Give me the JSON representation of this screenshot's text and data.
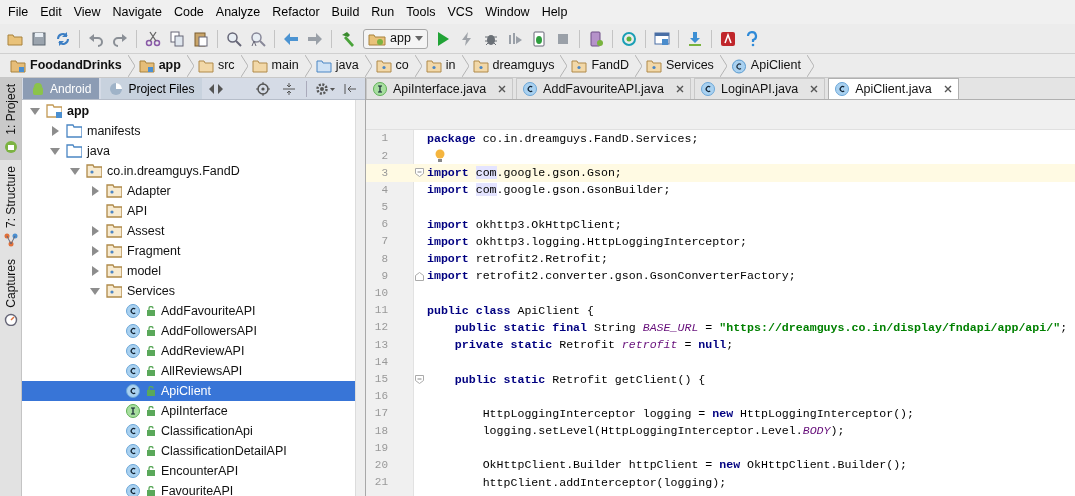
{
  "menu": [
    {
      "label": "File"
    },
    {
      "label": "Edit"
    },
    {
      "label": "View"
    },
    {
      "label": "Navigate"
    },
    {
      "label": "Code"
    },
    {
      "label": "Analyze"
    },
    {
      "label": "Refactor"
    },
    {
      "label": "Build"
    },
    {
      "label": "Run"
    },
    {
      "label": "Tools"
    },
    {
      "label": "VCS"
    },
    {
      "label": "Window"
    },
    {
      "label": "Help"
    }
  ],
  "toolbar": [
    {
      "kind": "open"
    },
    {
      "kind": "save"
    },
    {
      "kind": "sync"
    },
    {
      "kind": "separator"
    },
    {
      "kind": "undo"
    },
    {
      "kind": "redo"
    },
    {
      "kind": "separator"
    },
    {
      "kind": "cut"
    },
    {
      "kind": "copy"
    },
    {
      "kind": "paste"
    },
    {
      "kind": "separator"
    },
    {
      "kind": "find"
    },
    {
      "kind": "replace"
    },
    {
      "kind": "separator"
    },
    {
      "kind": "back"
    },
    {
      "kind": "forward"
    },
    {
      "kind": "separator"
    },
    {
      "kind": "build"
    },
    {
      "kind": "config",
      "label": "app"
    },
    {
      "kind": "run"
    },
    {
      "kind": "lightning"
    },
    {
      "kind": "debug"
    },
    {
      "kind": "profile"
    },
    {
      "kind": "attach"
    },
    {
      "kind": "stop"
    },
    {
      "kind": "separator"
    },
    {
      "kind": "avd"
    },
    {
      "kind": "separator"
    },
    {
      "kind": "gradle"
    },
    {
      "kind": "separator"
    },
    {
      "kind": "structure"
    },
    {
      "kind": "separator"
    },
    {
      "kind": "sdk"
    },
    {
      "kind": "separator"
    },
    {
      "kind": "monitor"
    },
    {
      "kind": "help"
    }
  ],
  "breadcrumbs": [
    {
      "label": "FoodandDrinks",
      "kind": "project"
    },
    {
      "label": "app",
      "kind": "module"
    },
    {
      "label": "src",
      "kind": "folder"
    },
    {
      "label": "main",
      "kind": "folder"
    },
    {
      "label": "java",
      "kind": "source"
    },
    {
      "label": "co",
      "kind": "package"
    },
    {
      "label": "in",
      "kind": "package"
    },
    {
      "label": "dreamguys",
      "kind": "package"
    },
    {
      "label": "FandD",
      "kind": "package"
    },
    {
      "label": "Services",
      "kind": "package"
    },
    {
      "label": "ApiClient",
      "kind": "class"
    }
  ],
  "side_tabs": [
    {
      "label": "1: Project",
      "kind": "project",
      "selected": true
    },
    {
      "label": "7: Structure",
      "kind": "structure",
      "selected": false
    },
    {
      "label": "Captures",
      "kind": "captures",
      "selected": false
    }
  ],
  "project_pane": {
    "views": [
      {
        "label": "Android",
        "kind": "android",
        "selected": true
      },
      {
        "label": "Project Files",
        "kind": "files",
        "selected": false
      }
    ],
    "tree": [
      {
        "label": "app",
        "kind": "module",
        "expanded": true,
        "selected": false,
        "children": [
          {
            "label": "manifests",
            "kind": "folder",
            "expanded": false,
            "selected": false
          },
          {
            "label": "java",
            "kind": "folder",
            "expanded": true,
            "selected": false,
            "children": [
              {
                "label": "co.in.dreamguys.FandD",
                "kind": "package",
                "expanded": true,
                "selected": false,
                "children": [
                  {
                    "label": "Adapter",
                    "kind": "package",
                    "expanded": false,
                    "selected": false
                  },
                  {
                    "label": "API",
                    "kind": "package",
                    "selected": false
                  },
                  {
                    "label": "Assest",
                    "kind": "package",
                    "expanded": false,
                    "selected": false
                  },
                  {
                    "label": "Fragment",
                    "kind": "package",
                    "expanded": false,
                    "selected": false
                  },
                  {
                    "label": "model",
                    "kind": "package",
                    "expanded": false,
                    "selected": false
                  },
                  {
                    "label": "Services",
                    "kind": "package",
                    "expanded": true,
                    "selected": false,
                    "children": [
                      {
                        "label": "AddFavouriteAPI",
                        "kind": "class",
                        "selected": false
                      },
                      {
                        "label": "AddFollowersAPI",
                        "kind": "class",
                        "selected": false
                      },
                      {
                        "label": "AddReviewAPI",
                        "kind": "class",
                        "selected": false
                      },
                      {
                        "label": "AllReviewsAPI",
                        "kind": "class",
                        "selected": false
                      },
                      {
                        "label": "ApiClient",
                        "kind": "class",
                        "selected": true
                      },
                      {
                        "label": "ApiInterface",
                        "kind": "interface",
                        "selected": false
                      },
                      {
                        "label": "ClassificationApi",
                        "kind": "class",
                        "selected": false
                      },
                      {
                        "label": "ClassificationDetailAPI",
                        "kind": "class",
                        "selected": false
                      },
                      {
                        "label": "EncounterAPI",
                        "kind": "class",
                        "selected": false
                      },
                      {
                        "label": "FavouriteAPI",
                        "kind": "class",
                        "selected": false
                      }
                    ]
                  }
                ]
              }
            ]
          }
        ]
      }
    ]
  },
  "editor": {
    "tabs": [
      {
        "label": "ApiInterface.java",
        "kind": "interface",
        "selected": false
      },
      {
        "label": "AddFavouriteAPI.java",
        "kind": "class",
        "selected": false
      },
      {
        "label": "LoginAPI.java",
        "kind": "class",
        "selected": false
      },
      {
        "label": "ApiClient.java",
        "kind": "class",
        "selected": true
      }
    ],
    "lines": [
      {
        "number": "1",
        "tokens": [
          {
            "kind": "keyword",
            "text": "package"
          },
          {
            "kind": "plain",
            "text": " co.in.dreamguys.FandD.Services;"
          }
        ]
      },
      {
        "number": "2",
        "bulb": true
      },
      {
        "number": "3",
        "current": true,
        "fold_start": true,
        "tokens": [
          {
            "kind": "keyword",
            "text": "import "
          },
          {
            "kind": "marked",
            "text": "com"
          },
          {
            "kind": "plain",
            "text": ".google.gson.Gson;"
          }
        ]
      },
      {
        "number": "4",
        "tokens": [
          {
            "kind": "keyword",
            "text": "import "
          },
          {
            "kind": "marked",
            "text": "com"
          },
          {
            "kind": "plain",
            "text": ".google.gson.GsonBuilder;"
          }
        ]
      },
      {
        "number": "5"
      },
      {
        "number": "6",
        "tokens": [
          {
            "kind": "keyword",
            "text": "import"
          },
          {
            "kind": "plain",
            "text": " okhttp3.OkHttpClient;"
          }
        ]
      },
      {
        "number": "7",
        "tokens": [
          {
            "kind": "keyword",
            "text": "import"
          },
          {
            "kind": "plain",
            "text": " okhttp3.logging.HttpLoggingInterceptor;"
          }
        ]
      },
      {
        "number": "8",
        "tokens": [
          {
            "kind": "keyword",
            "text": "import"
          },
          {
            "kind": "plain",
            "text": " retrofit2.Retrofit;"
          }
        ]
      },
      {
        "number": "9",
        "fold_end": true,
        "tokens": [
          {
            "kind": "keyword",
            "text": "import"
          },
          {
            "kind": "plain",
            "text": " retrofit2.converter.gson.GsonConverterFactory;"
          }
        ]
      },
      {
        "number": "10"
      },
      {
        "number": "11",
        "tokens": [
          {
            "kind": "keyword",
            "text": "public class"
          },
          {
            "kind": "plain",
            "text": " ApiClient {"
          }
        ]
      },
      {
        "number": "12",
        "tokens": [
          {
            "kind": "keyword",
            "text": "    public static final"
          },
          {
            "kind": "plain",
            "text": " String "
          },
          {
            "kind": "field",
            "text": "BASE_URL"
          },
          {
            "kind": "plain",
            "text": " = "
          },
          {
            "kind": "string",
            "text": "\"https://dreamguys.co.in/display/fndapi/app/api/\""
          },
          {
            "kind": "plain",
            "text": ";"
          }
        ]
      },
      {
        "number": "13",
        "tokens": [
          {
            "kind": "keyword",
            "text": "    private static"
          },
          {
            "kind": "plain",
            "text": " Retrofit "
          },
          {
            "kind": "field",
            "text": "retrofit"
          },
          {
            "kind": "plain",
            "text": " = "
          },
          {
            "kind": "keyword",
            "text": "null"
          },
          {
            "kind": "plain",
            "text": ";"
          }
        ]
      },
      {
        "number": "14"
      },
      {
        "number": "15",
        "fold_start": true,
        "tokens": [
          {
            "kind": "keyword",
            "text": "    public static"
          },
          {
            "kind": "plain",
            "text": " Retrofit getClient() {"
          }
        ]
      },
      {
        "number": "16"
      },
      {
        "number": "17",
        "tokens": [
          {
            "kind": "plain",
            "text": "        HttpLoggingInterceptor logging = "
          },
          {
            "kind": "keyword",
            "text": "new"
          },
          {
            "kind": "plain",
            "text": " HttpLoggingInterceptor();"
          }
        ]
      },
      {
        "number": "18",
        "tokens": [
          {
            "kind": "plain",
            "text": "        logging.setLevel(HttpLoggingInterceptor.Level."
          },
          {
            "kind": "field",
            "text": "BODY"
          },
          {
            "kind": "plain",
            "text": ");"
          }
        ]
      },
      {
        "number": "19"
      },
      {
        "number": "20",
        "tokens": [
          {
            "kind": "plain",
            "text": "        OkHttpClient.Builder httpClient = "
          },
          {
            "kind": "keyword",
            "text": "new"
          },
          {
            "kind": "plain",
            "text": " OkHttpClient.Builder();"
          }
        ]
      },
      {
        "number": "21",
        "tokens": [
          {
            "kind": "plain",
            "text": "        httpClient.addInterceptor(logging);"
          }
        ]
      }
    ]
  }
}
